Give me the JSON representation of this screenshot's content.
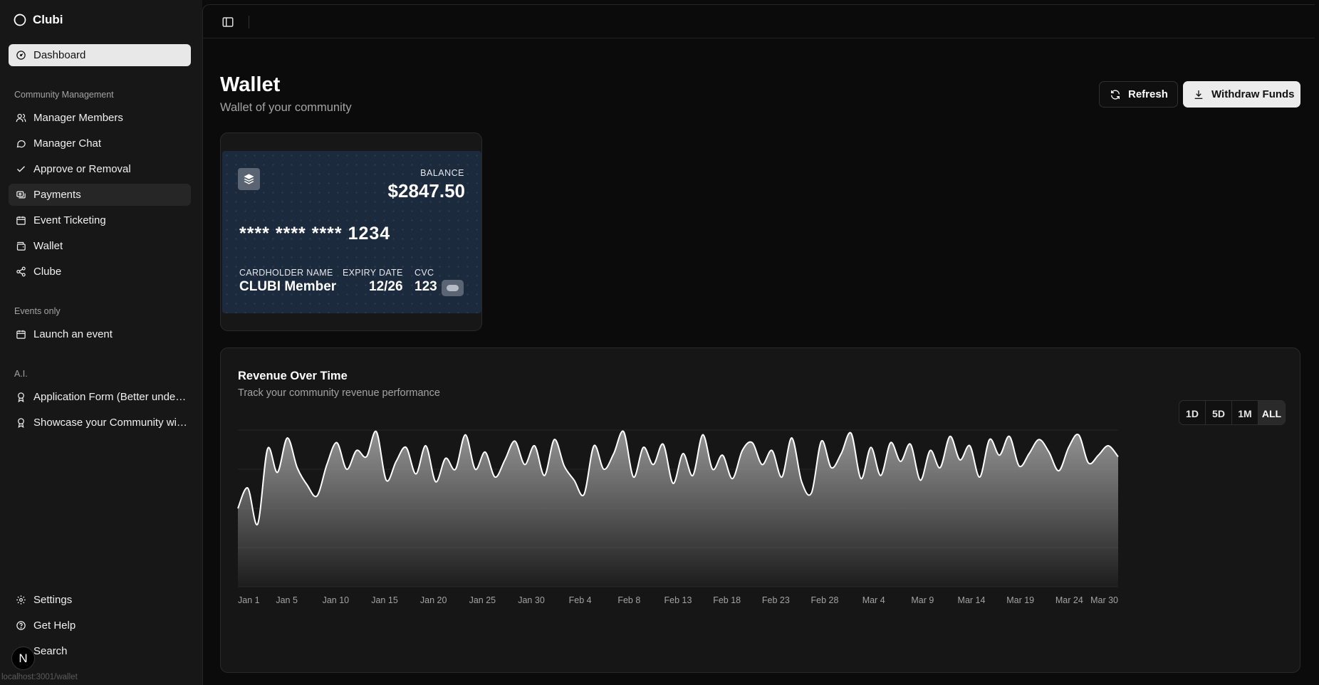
{
  "app": {
    "name": "Clubi"
  },
  "sidebar": {
    "dashboard": {
      "label": "Dashboard",
      "icon": "dashboard-icon"
    },
    "sections": [
      {
        "title": "Community Management"
      },
      {
        "title": "Events only"
      },
      {
        "title": "A.I."
      }
    ],
    "community_items": [
      {
        "label": "Manager Members",
        "icon": "users-icon"
      },
      {
        "label": "Manager Chat",
        "icon": "chat-icon"
      },
      {
        "label": "Approve or Removal",
        "icon": "check-icon"
      },
      {
        "label": "Payments",
        "icon": "payments-icon",
        "active": true
      },
      {
        "label": "Event Ticketing",
        "icon": "calendar-icon"
      },
      {
        "label": "Wallet",
        "icon": "wallet-icon"
      },
      {
        "label": "Clube",
        "icon": "share-icon"
      }
    ],
    "events_items": [
      {
        "label": "Launch an event",
        "icon": "calendar-icon"
      }
    ],
    "ai_items": [
      {
        "label": "Application Form (Better understanding)",
        "icon": "award-icon"
      },
      {
        "label": "Showcase your Community with AI",
        "icon": "award-icon"
      }
    ],
    "footer_items": [
      {
        "label": "Settings",
        "icon": "gear-icon"
      },
      {
        "label": "Get Help",
        "icon": "help-icon"
      },
      {
        "label": "Search",
        "icon": "search-icon"
      }
    ],
    "avatar_letter": "N",
    "status_url": "localhost:3001/wallet"
  },
  "page": {
    "title": "Wallet",
    "subtitle": "Wallet of your community",
    "refresh_label": "Refresh",
    "withdraw_label": "Withdraw Funds"
  },
  "card": {
    "balance_label": "BALANCE",
    "balance": "$2847.50",
    "number": "**** **** **** 1234",
    "holder_label": "CARDHOLDER NAME",
    "holder": "CLUBI Member",
    "expiry_label": "EXPIRY DATE",
    "expiry": "12/26",
    "cvc_label": "CVC",
    "cvc": "123",
    "card_color": "#1c2a3d"
  },
  "chart": {
    "title": "Revenue Over Time",
    "subtitle": "Track your community revenue performance",
    "ranges": [
      "1D",
      "5D",
      "1M",
      "ALL"
    ],
    "selected_range": "ALL"
  },
  "chart_data": {
    "type": "area",
    "xlabel": "",
    "ylabel": "",
    "grid": true,
    "smooth": true,
    "line_color": "#ffffff",
    "fill": "gradient gray to black",
    "x_tick_labels": [
      "Jan 1",
      "Jan 5",
      "Jan 10",
      "Jan 15",
      "Jan 20",
      "Jan 25",
      "Jan 30",
      "Feb 4",
      "Feb 8",
      "Feb 13",
      "Feb 18",
      "Feb 23",
      "Feb 28",
      "Mar 4",
      "Mar 9",
      "Mar 14",
      "Mar 19",
      "Mar 24",
      "Mar 30"
    ],
    "ylim": [
      0,
      100
    ],
    "x": [
      "Jan 1",
      "Jan 2",
      "Jan 3",
      "Jan 4",
      "Jan 5",
      "Jan 6",
      "Jan 7",
      "Jan 8",
      "Jan 9",
      "Jan 10",
      "Jan 11",
      "Jan 12",
      "Jan 13",
      "Jan 14",
      "Jan 15",
      "Jan 16",
      "Jan 17",
      "Jan 18",
      "Jan 19",
      "Jan 20",
      "Jan 21",
      "Jan 22",
      "Jan 23",
      "Jan 24",
      "Jan 25",
      "Jan 26",
      "Jan 27",
      "Jan 28",
      "Jan 29",
      "Jan 30",
      "Jan 31",
      "Feb 1",
      "Feb 2",
      "Feb 3",
      "Feb 4",
      "Feb 5",
      "Feb 6",
      "Feb 7",
      "Feb 8",
      "Feb 9",
      "Feb 10",
      "Feb 11",
      "Feb 12",
      "Feb 13",
      "Feb 14",
      "Feb 15",
      "Feb 16",
      "Feb 17",
      "Feb 18",
      "Feb 19",
      "Feb 20",
      "Feb 21",
      "Feb 22",
      "Feb 23",
      "Feb 24",
      "Feb 25",
      "Feb 26",
      "Feb 27",
      "Feb 28",
      "Feb 29",
      "Mar 1",
      "Mar 2",
      "Mar 3",
      "Mar 4",
      "Mar 5",
      "Mar 6",
      "Mar 7",
      "Mar 8",
      "Mar 9",
      "Mar 10",
      "Mar 11",
      "Mar 12",
      "Mar 13",
      "Mar 14",
      "Mar 15",
      "Mar 16",
      "Mar 17",
      "Mar 18",
      "Mar 19",
      "Mar 20",
      "Mar 21",
      "Mar 22",
      "Mar 23",
      "Mar 24",
      "Mar 25",
      "Mar 26",
      "Mar 27",
      "Mar 28",
      "Mar 29",
      "Mar 30"
    ],
    "values": [
      50,
      63,
      40,
      88,
      73,
      95,
      76,
      65,
      58,
      78,
      92,
      75,
      87,
      83,
      99,
      68,
      80,
      89,
      72,
      90,
      67,
      82,
      75,
      97,
      75,
      86,
      70,
      81,
      93,
      78,
      90,
      71,
      94,
      77,
      68,
      59,
      90,
      75,
      85,
      99,
      70,
      89,
      78,
      91,
      66,
      85,
      71,
      97,
      75,
      84,
      69,
      87,
      92,
      78,
      87,
      70,
      95,
      67,
      60,
      93,
      76,
      85,
      98,
      69,
      89,
      71,
      92,
      80,
      91,
      68,
      87,
      76,
      96,
      81,
      90,
      70,
      94,
      84,
      96,
      77,
      85,
      94,
      86,
      74,
      89,
      97,
      79,
      84,
      90,
      83
    ]
  }
}
